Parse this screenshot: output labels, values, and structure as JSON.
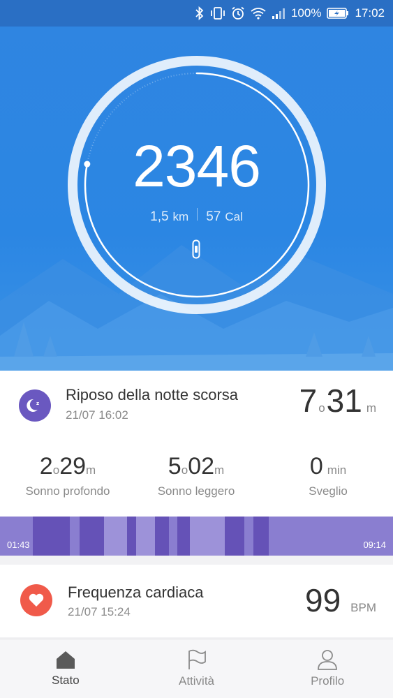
{
  "status_bar": {
    "battery_percent": "100%",
    "time": "17:02",
    "icons": [
      "bluetooth-icon",
      "vibrate-icon",
      "alarm-icon",
      "wifi-icon",
      "signal-icon",
      "battery-icon"
    ]
  },
  "steps": {
    "count": "2346",
    "distance_value": "1,5",
    "distance_unit": "km",
    "calories_value": "57",
    "calories_unit": "Cal",
    "ring_progress": 0.78
  },
  "sleep": {
    "title": "Riposo della notte scorsa",
    "timestamp": "21/07 16:02",
    "total_hours": "7",
    "hours_unit": "o",
    "total_minutes": "31",
    "minutes_unit": "m",
    "deep": {
      "hours": "2",
      "hours_unit": "o",
      "minutes": "29",
      "minutes_unit": "m",
      "label": "Sonno profondo"
    },
    "light": {
      "hours": "5",
      "hours_unit": "o",
      "minutes": "02",
      "minutes_unit": "m",
      "label": "Sonno leggero"
    },
    "awake": {
      "minutes": "0",
      "unit": "min",
      "label": "Sveglio"
    },
    "start_time": "01:43",
    "end_time": "09:14",
    "colors": {
      "deep": "#6552b7",
      "light": "#8a7ed0",
      "icon": "#6a58c0"
    }
  },
  "heart_rate": {
    "title": "Frequenza cardiaca",
    "timestamp": "21/07 15:24",
    "value": "99",
    "unit": "BPM",
    "color": "#f05a4a"
  },
  "bottom_nav": {
    "items": [
      {
        "label": "Stato",
        "icon": "home-icon",
        "active": true
      },
      {
        "label": "Attività",
        "icon": "flag-icon",
        "active": false
      },
      {
        "label": "Profilo",
        "icon": "person-icon",
        "active": false
      }
    ]
  }
}
